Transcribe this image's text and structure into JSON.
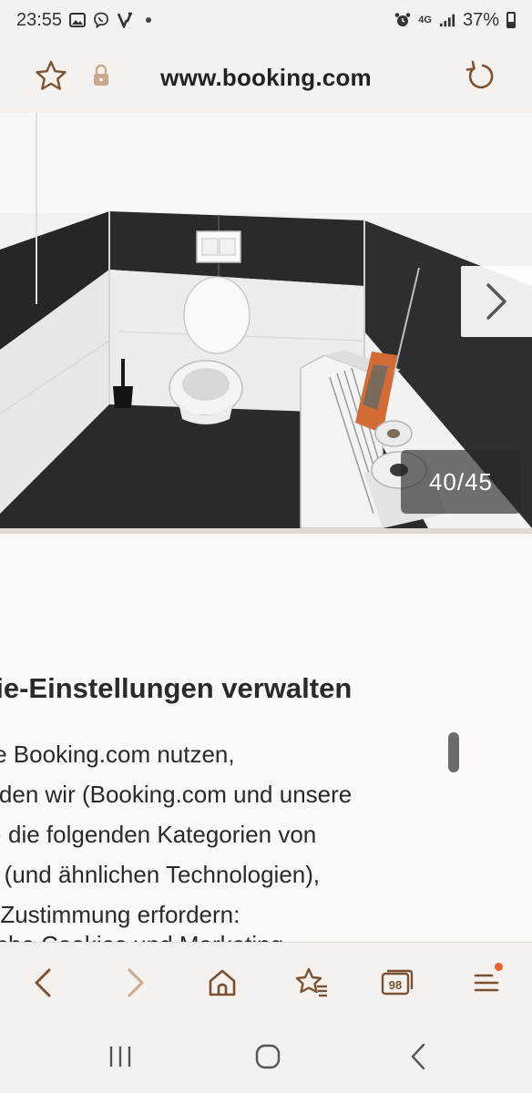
{
  "status_bar": {
    "time": "23:55",
    "network": "4G",
    "battery": "37%"
  },
  "address_bar": {
    "url": "www.booking.com"
  },
  "gallery": {
    "counter": "40/45",
    "description": "Bathroom with toilet, white and black tiles, radiator with toilet paper rolls"
  },
  "cookie_dialog": {
    "title": "kie-Einstellungen verwalten",
    "lines": [
      " Sie Booking.com nutzen,",
      "enden wir (Booking.com und unsere",
      "er) die folgenden Kategorien von",
      "es (und ähnlichen Technologien),",
      "re Zustimmung erfordern:"
    ],
    "cut_line": "tische Cookies und Marketing"
  },
  "toolbar": {
    "tabs_count": "98"
  },
  "colors": {
    "accent": "#7a5233",
    "notification_dot": "#e9632c"
  }
}
